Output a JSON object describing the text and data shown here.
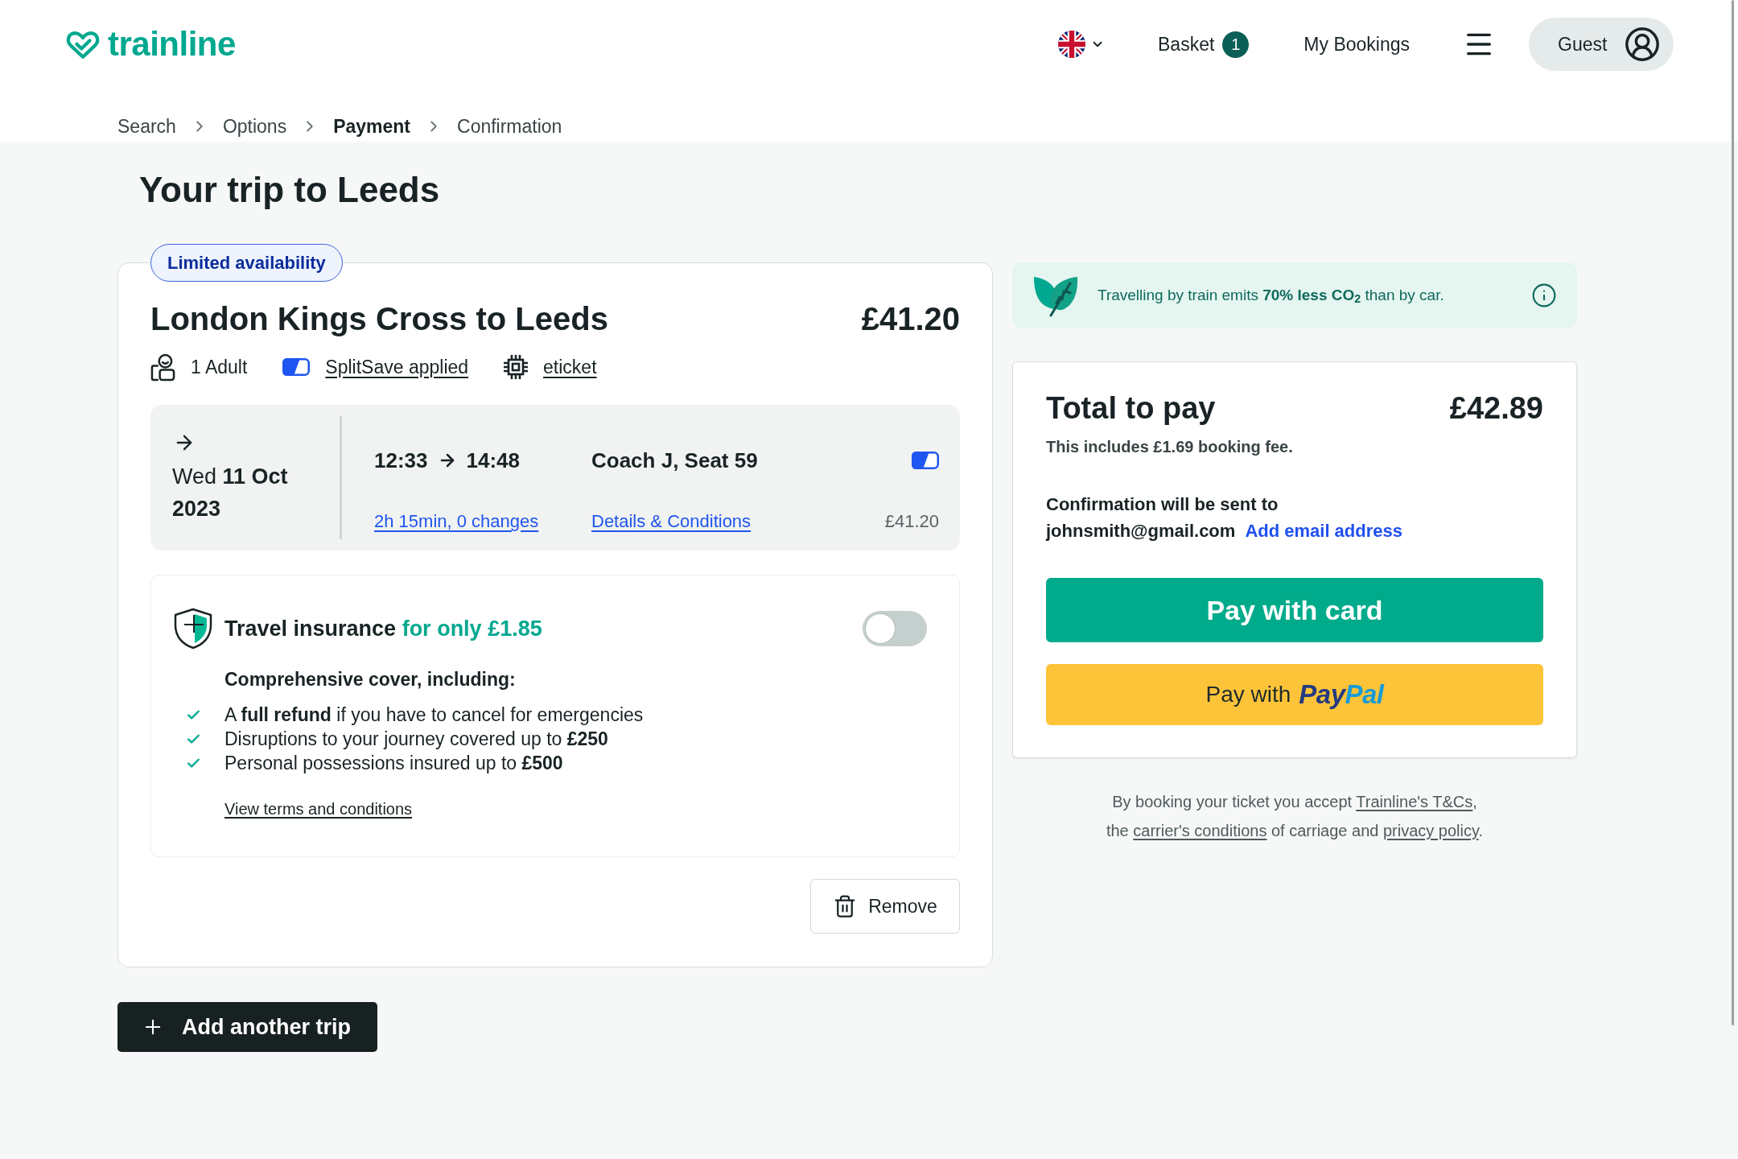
{
  "header": {
    "logo": "trainline",
    "basket": {
      "label": "Basket",
      "count": "1"
    },
    "my_bookings": "My Bookings",
    "account": "Guest"
  },
  "breadcrumb": [
    {
      "label": "Search",
      "selected": false
    },
    {
      "label": "Options",
      "selected": false
    },
    {
      "label": "Payment",
      "selected": true
    },
    {
      "label": "Confirmation",
      "selected": false
    }
  ],
  "page_title": "Your trip to Leeds",
  "trip": {
    "badge": "Limited availability",
    "route": "London Kings Cross to Leeds",
    "price": "£41.20",
    "details": [
      {
        "kind": "passengers",
        "label": "1 Adult"
      },
      {
        "kind": "splitsave",
        "label": "SplitSave applied"
      },
      {
        "kind": "ticket",
        "label": "eticket"
      }
    ],
    "journey": {
      "date": "Wed **11 Oct 2023**",
      "departure": "12:33",
      "arrival": "14:48",
      "duration": "2h 15min, 0 changes",
      "seat": "Coach J, Seat 59",
      "conditions_link": "Details & Conditions",
      "fare": "£41.20"
    },
    "insurance": {
      "title": "Travel insurance",
      "offer": "for only £1.85",
      "on": false,
      "subtitle": "Comprehensive cover, including:",
      "benefits": [
        "A **full refund** if you have to cancel for emergencies",
        "Disruptions to your journey covered up to **£250**",
        "Personal possessions insured up to **£500**"
      ],
      "terms_link": "View terms and conditions"
    },
    "remove_button": "Remove"
  },
  "add_trip_button": "Add another trip",
  "co2_banner": "Travelling by train emits **70% less CO$_{2}$** than by car.",
  "summary": {
    "title": "Total to pay",
    "amount": "£42.89",
    "fee_note": "This includes £1.69 booking fee.",
    "confirmation_label": "Confirmation will be sent to",
    "email": "johnsmith@gmail.com",
    "add_email_link": "Add email address"
  },
  "pay_card_button": "Pay with card",
  "paypal_button": {
    "label": "Pay with",
    "logo": [
      "Pay",
      "Pal"
    ]
  },
  "legal": [
    [
      {
        "kind": "text",
        "text": "By booking your ticket you accept "
      },
      {
        "kind": "link",
        "text": "Trainline's T&Cs"
      },
      {
        "kind": "text",
        "text": ","
      }
    ],
    [
      {
        "kind": "text",
        "text": "the "
      },
      {
        "kind": "link",
        "text": "carrier's conditions"
      },
      {
        "kind": "text",
        "text": " of carriage and "
      },
      {
        "kind": "link",
        "text": "privacy policy"
      },
      {
        "kind": "text",
        "text": "."
      }
    ]
  ]
}
